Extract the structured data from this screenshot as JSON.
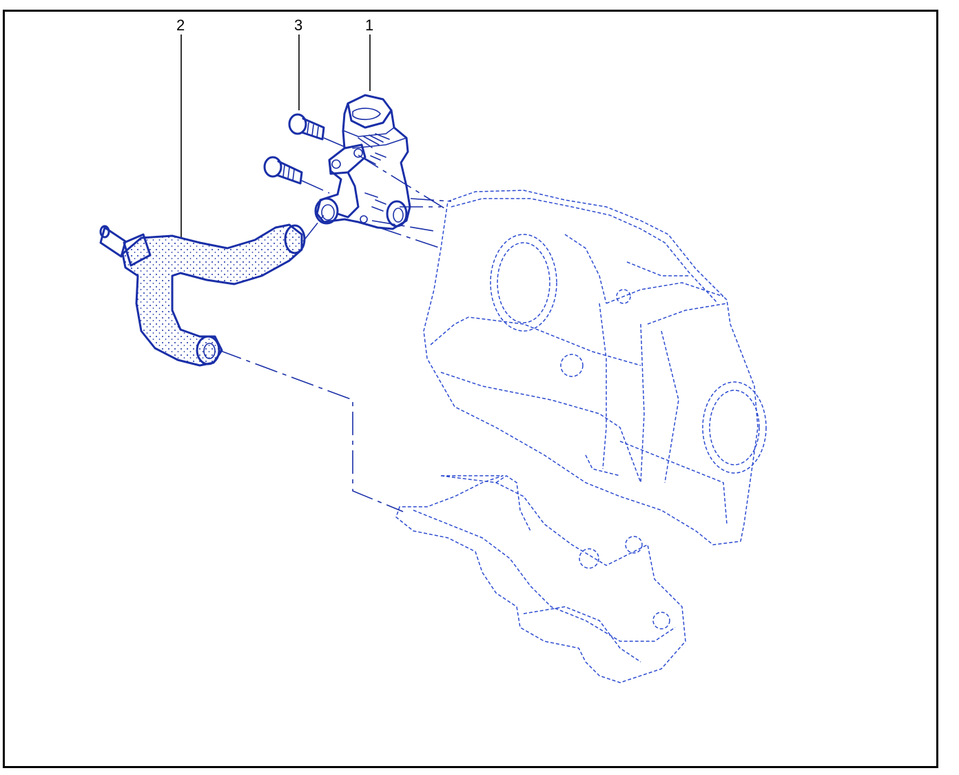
{
  "callouts": [
    {
      "id": "callout-1",
      "text": "1"
    },
    {
      "id": "callout-2",
      "text": "2"
    },
    {
      "id": "callout-3",
      "text": "3"
    }
  ],
  "colors": {
    "line_art": "#1a2fa8",
    "ghost_lines": "#2b4ad0",
    "frame": "#000000",
    "background": "#ffffff"
  }
}
